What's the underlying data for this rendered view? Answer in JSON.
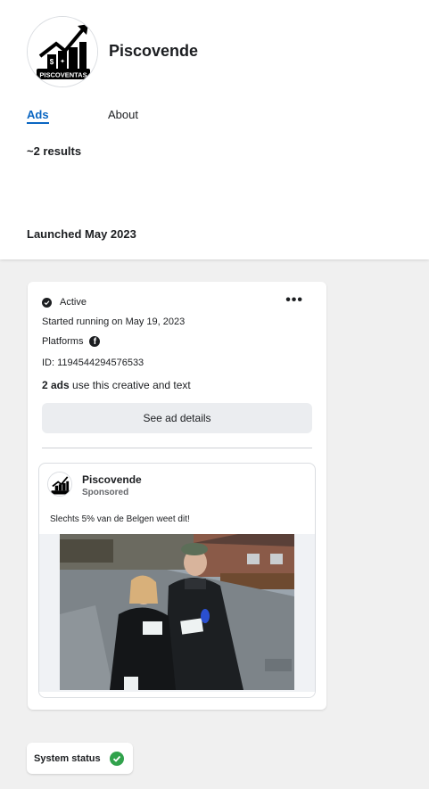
{
  "page": {
    "name": "Piscovende",
    "logo_text": "PISCOVENTAS"
  },
  "tabs": [
    {
      "label": "Ads"
    },
    {
      "label": "About"
    }
  ],
  "results": "~2 results",
  "section_title": "Launched May 2023",
  "ad_card": {
    "status": "Active",
    "more_label": "•••",
    "started": "Started running on May 19, 2023",
    "platforms_label": "Platforms",
    "platform_icon": "facebook-icon",
    "id_text": "ID: 1194544294576533",
    "ads_count_bold": "2 ads",
    "ads_count_rest": " use this creative and text",
    "details_button": "See ad details"
  },
  "ad_preview": {
    "advertiser": "Piscovende",
    "sponsored": "Sponsored",
    "body_text": "Slechts 5% van de Belgen weet dit!"
  },
  "system_status": {
    "label": "System status",
    "icon": "check-circle-icon"
  },
  "colors": {
    "accent": "#0a66c2",
    "status_ok": "#31a24c"
  }
}
